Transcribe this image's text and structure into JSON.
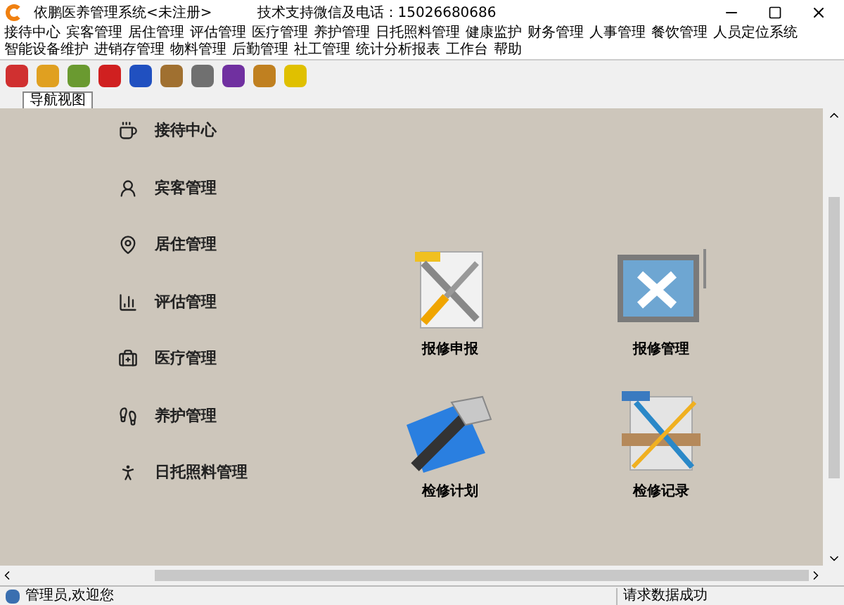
{
  "window": {
    "title": "依鹏医养管理系统<未注册>",
    "support": "技术支持微信及电话：15026680686"
  },
  "menu": [
    "接待中心",
    "宾客管理",
    "居住管理",
    "评估管理",
    "医疗管理",
    "养护管理",
    "日托照料管理",
    "健康监护",
    "财务管理",
    "人事管理",
    "餐饮管理",
    "人员定位系统",
    "智能设备维护",
    "进销存管理",
    "物料管理",
    "后勤管理",
    "社工管理",
    "统计分析报表",
    "工作台",
    "帮助"
  ],
  "tabs": [
    {
      "label": "导航视图",
      "selected": true
    }
  ],
  "nav_items": [
    {
      "label": "接待中心",
      "kind": "coffee"
    },
    {
      "label": "宾客管理",
      "kind": "guest"
    },
    {
      "label": "居住管理",
      "kind": "residence"
    },
    {
      "label": "评估管理",
      "kind": "chart"
    },
    {
      "label": "医疗管理",
      "kind": "medical"
    },
    {
      "label": "养护管理",
      "kind": "care"
    },
    {
      "label": "日托照料管理",
      "kind": "daycare"
    }
  ],
  "tiles": [
    {
      "label": "报修申报",
      "kind": "tools"
    },
    {
      "label": "报修管理",
      "kind": "board"
    },
    {
      "label": "检修计划",
      "kind": "hammer"
    },
    {
      "label": "检修记录",
      "kind": "brush"
    }
  ],
  "status_bar": {
    "user": "管理员,欢迎您",
    "message": "请求数据成功"
  }
}
